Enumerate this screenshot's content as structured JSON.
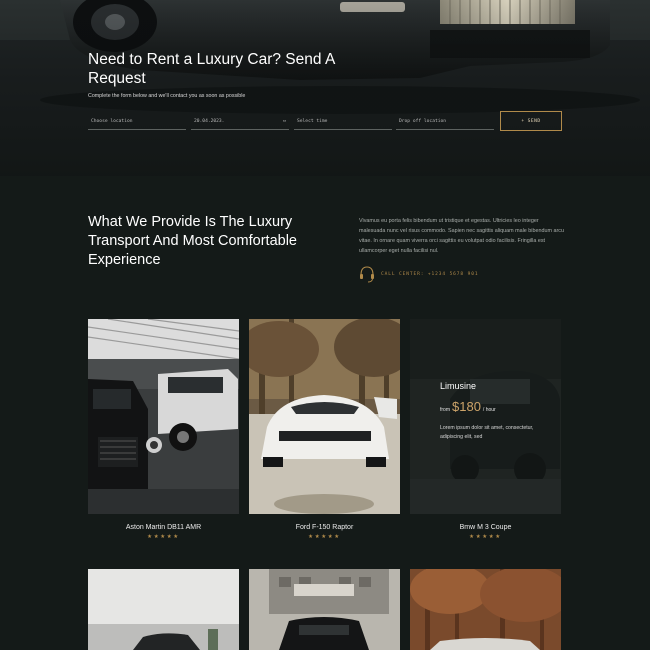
{
  "hero": {
    "title": "Need to Rent a Luxury Car? Send A Request",
    "subtitle": "Complete the form below and we'll contact you as soon as possible",
    "fields": [
      {
        "label": "Choose location"
      },
      {
        "label": "20.04.2023."
      },
      {
        "label": "Select time"
      },
      {
        "label": "Drop off location"
      }
    ],
    "send_label": "SEND"
  },
  "about": {
    "title": "What We Provide Is The Luxury Transport And Most Comfortable Experience",
    "text": "Vivamus eu porta felis bibendum ut tristique et egestas. Ultricies leo integer malesuada nunc vel risus commodo. Sapien nec sagittis aliquam male bibendum arcu vitae. In ornare quam viverra orci sagittis eu volutpat odio facilisis. Fringilla est ullamcorper eget nulla facilisi nul.",
    "call_text": "CALL CENTER: +1234 5678 901"
  },
  "cars": [
    {
      "name": "Aston Martin DB11 AMR",
      "stars": "★★★★★"
    },
    {
      "name": "Ford F-150 Raptor",
      "stars": "★★★★★"
    },
    {
      "name": "Bmw M 3 Coupe",
      "stars": "★★★★★",
      "overlay_name": "Limusine",
      "overlay_from": "from",
      "overlay_price": "$180",
      "overlay_unit": "/ hour",
      "overlay_desc": "Lorem ipsum dolor sit amet, consectetur, adipiscing elit, sed"
    }
  ],
  "icons": {
    "date": "calendar-icon",
    "send": "plus-icon",
    "call": "headset-icon",
    "rating": "star-icon"
  },
  "colors": {
    "accent": "#b08a4a",
    "background": "#141a18",
    "text_muted": "#a9aeab"
  }
}
